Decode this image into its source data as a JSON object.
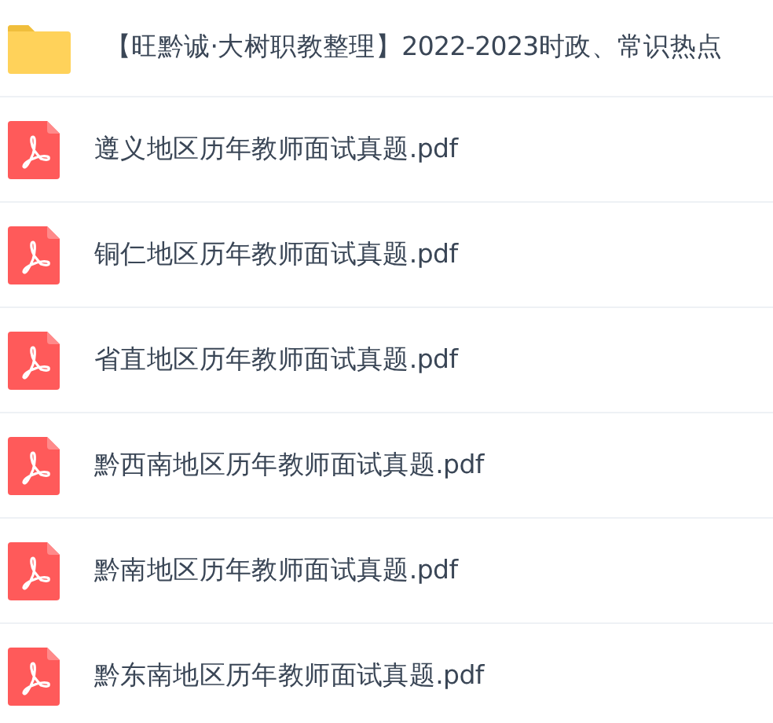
{
  "files": [
    {
      "kind": "folder",
      "name": "【旺黔诚·大树职教整理】2022-2023时政、常识热点"
    },
    {
      "kind": "pdf",
      "name": "遵义地区历年教师面试真题.pdf"
    },
    {
      "kind": "pdf",
      "name": "铜仁地区历年教师面试真题.pdf"
    },
    {
      "kind": "pdf",
      "name": "省直地区历年教师面试真题.pdf"
    },
    {
      "kind": "pdf",
      "name": "黔西南地区历年教师面试真题.pdf"
    },
    {
      "kind": "pdf",
      "name": "黔南地区历年教师面试真题.pdf"
    },
    {
      "kind": "pdf",
      "name": "黔东南地区历年教师面试真题.pdf"
    }
  ]
}
